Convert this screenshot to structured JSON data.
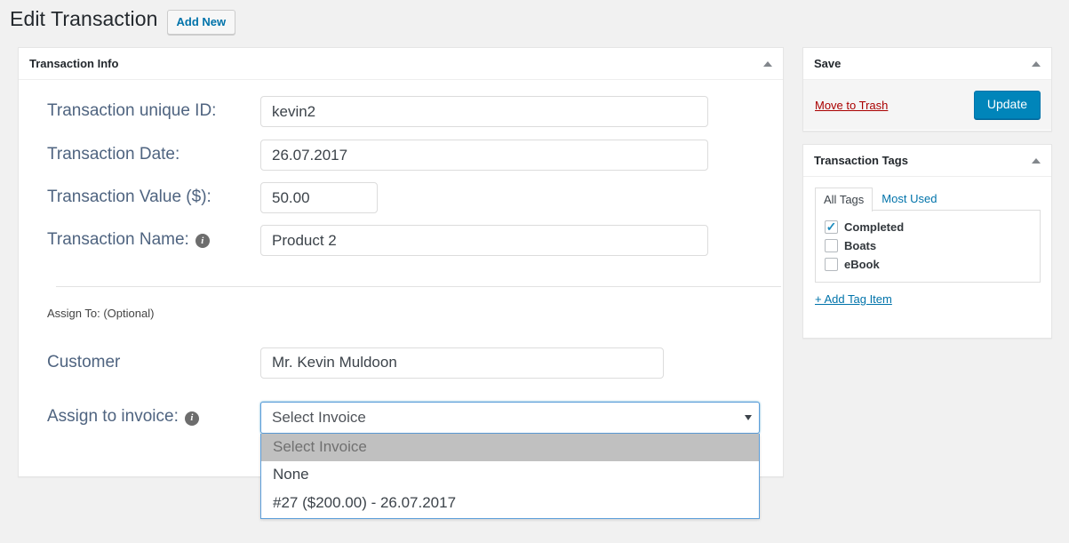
{
  "header": {
    "title": "Edit Transaction",
    "add_new_label": "Add New"
  },
  "main_panel": {
    "title": "Transaction Info",
    "toggle_icon": "triangle-up-icon",
    "fields": [
      {
        "label": "Transaction unique ID:",
        "value": "kevin2"
      },
      {
        "label": "Transaction Date:",
        "value": "26.07.2017"
      },
      {
        "label": "Transaction Value ($):",
        "value": "50.00"
      },
      {
        "label": "Transaction Name:",
        "value": "Product 2",
        "info_icon": "info-icon"
      }
    ],
    "assign_section": {
      "heading": "Assign To: (Optional)",
      "customer_label": "Customer",
      "customer_value": "Mr. Kevin Muldoon",
      "invoice_label": "Assign to invoice:",
      "invoice_info_icon": "info-icon",
      "invoice_selected": "Select Invoice",
      "invoice_options": [
        "Select Invoice",
        "None",
        "#27 ($200.00) - 26.07.2017"
      ]
    }
  },
  "sidebar": {
    "save_panel": {
      "title": "Save",
      "toggle_icon": "triangle-up-icon",
      "trash_label": "Move to Trash",
      "update_label": "Update"
    },
    "tags_panel": {
      "title": "Transaction Tags",
      "toggle_icon": "triangle-up-icon",
      "tabs": [
        {
          "label": "All Tags",
          "active": true
        },
        {
          "label": "Most Used",
          "active": false
        }
      ],
      "tags": [
        {
          "label": "Completed",
          "checked": true
        },
        {
          "label": "Boats",
          "checked": false
        },
        {
          "label": "eBook",
          "checked": false
        }
      ],
      "add_tag_label": "+ Add Tag Item"
    }
  },
  "colors": {
    "accent_blue": "#0073aa",
    "button_blue": "#0085ba",
    "trash_red": "#a00",
    "page_bg": "#f1f1f1",
    "label_slate": "#4f6480",
    "option_highlight": "#c0c0c0"
  }
}
